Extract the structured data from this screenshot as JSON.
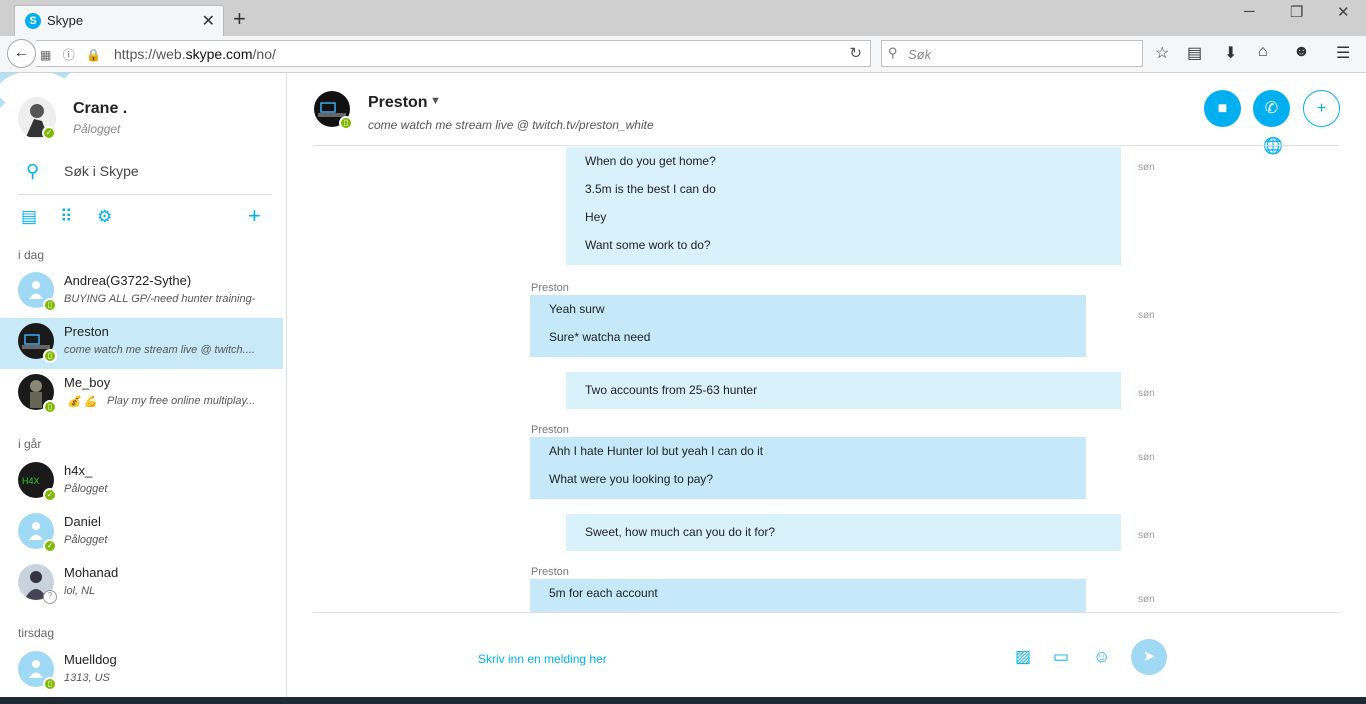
{
  "browser": {
    "tab_title": "Skype",
    "tab_favicon": "S",
    "url_prefix": "https://web.",
    "url_domain": "skype.com",
    "url_path": "/no/",
    "search_placeholder": "Søk"
  },
  "sidebar": {
    "me": {
      "name": "Crane .",
      "status": "Pålogget"
    },
    "search_label": "Søk i Skype",
    "sections": [
      {
        "label": "i dag"
      },
      {
        "label": "i går"
      },
      {
        "label": "tirsdag"
      }
    ],
    "contacts": [
      {
        "name": "Andrea(G3722-Sythe)",
        "sub": "BUYING ALL GP/-need hunter training-"
      },
      {
        "name": "Preston",
        "sub": "come watch me stream live @ twitch...."
      },
      {
        "name": "Me_boy",
        "sub": "Play my free online multiplay..."
      },
      {
        "name": "h4x_",
        "sub": "Pålogget"
      },
      {
        "name": "Daniel",
        "sub": "Pålogget"
      },
      {
        "name": "Mohanad",
        "sub": "lol, NL"
      },
      {
        "name": "Muelldog",
        "sub": "1313, US"
      }
    ]
  },
  "conversation": {
    "name": "Preston",
    "mood": "come watch me stream live @ twitch.tv/preston_white",
    "messages": [
      {
        "direction": "out",
        "lines": [
          "When do you get home?",
          "3.5m is the best I can do",
          "Hey",
          "Want some work to do?"
        ],
        "time": "søn"
      },
      {
        "direction": "in",
        "sender": "Preston",
        "lines": [
          "Yeah surw",
          "Sure* watcha need"
        ],
        "time": "søn"
      },
      {
        "direction": "out",
        "lines": [
          "Two accounts from 25-63 hunter"
        ],
        "time": "søn"
      },
      {
        "direction": "in",
        "sender": "Preston",
        "lines": [
          "Ahh I hate Hunter lol but yeah I can do it",
          "What were you looking to pay?"
        ],
        "time": "søn"
      },
      {
        "direction": "out",
        "lines": [
          "Sweet, how much can you do it for?"
        ],
        "time": "søn"
      },
      {
        "direction": "in",
        "sender": "Preston",
        "lines": [
          "5m for each account"
        ],
        "time": "søn"
      }
    ],
    "compose_placeholder": "Skriv inn en melding her"
  },
  "colors": {
    "accent": "#00aff0",
    "incoming_bubble": "#c5e9f8",
    "outgoing_bubble": "#d9f1fb",
    "online": "#7fba00"
  }
}
